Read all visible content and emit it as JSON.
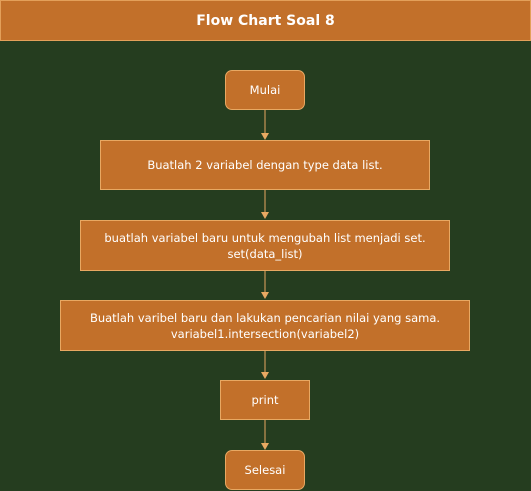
{
  "title": "Flow Chart Soal 8",
  "colors": {
    "background": "#253d1f",
    "node_fill": "#c2702a",
    "node_border": "#e8a862",
    "text": "#ffffff"
  },
  "nodes": [
    {
      "id": "start",
      "lines": [
        "Mulai"
      ]
    },
    {
      "id": "step1",
      "lines": [
        "Buatlah 2 variabel dengan type data list."
      ]
    },
    {
      "id": "step2",
      "lines": [
        "buatlah variabel baru untuk mengubah list menjadi set.",
        "set(data_list)"
      ]
    },
    {
      "id": "step3",
      "lines": [
        "Buatlah varibel baru dan lakukan pencarian nilai yang sama.",
        "variabel1.intersection(variabel2)"
      ]
    },
    {
      "id": "step4",
      "lines": [
        "print"
      ]
    },
    {
      "id": "end",
      "lines": [
        "Selesai"
      ]
    }
  ]
}
